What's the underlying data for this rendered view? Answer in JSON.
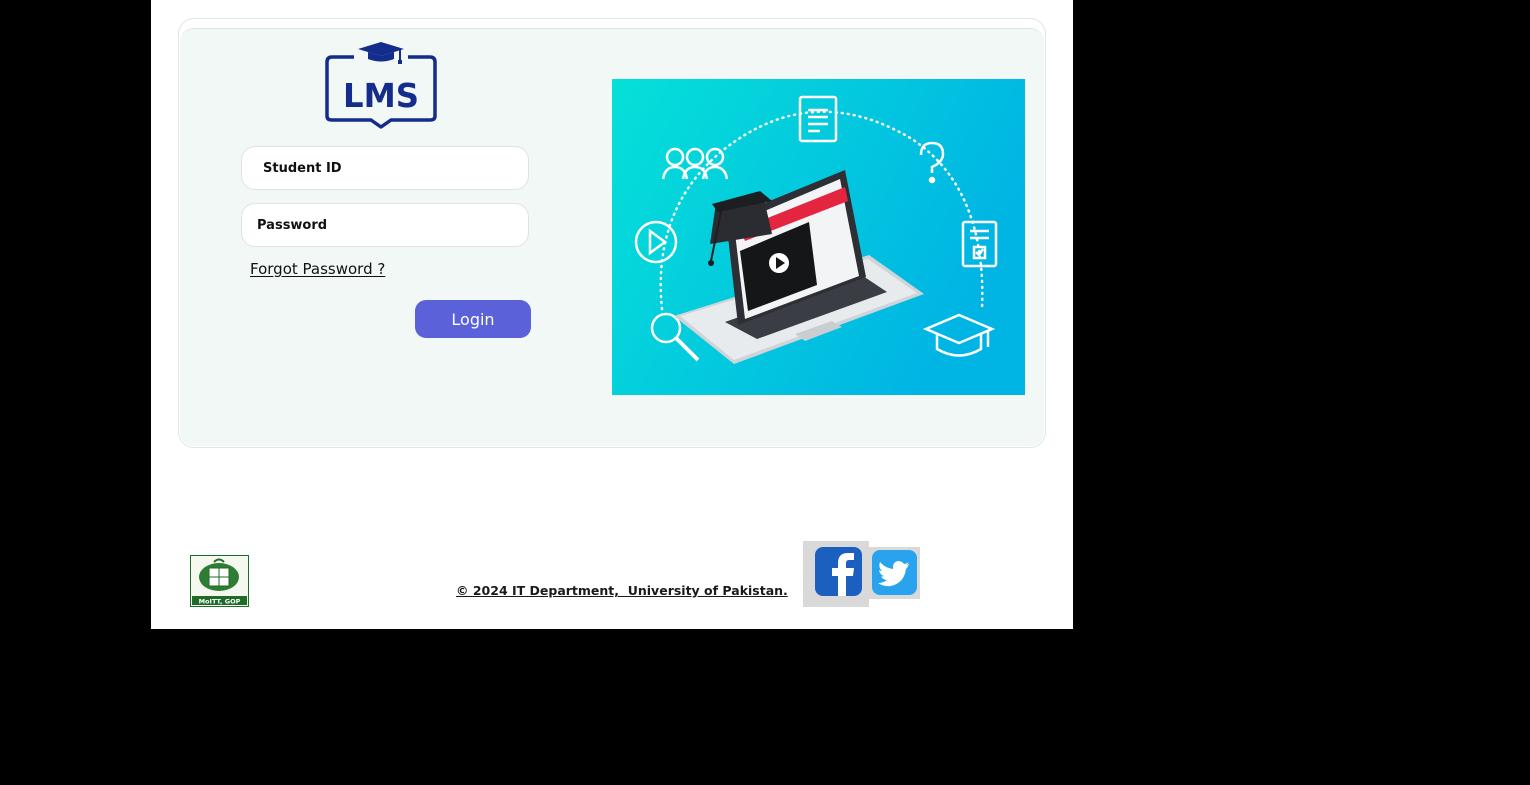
{
  "logo": {
    "text": "LMS",
    "icon": "graduation-cap-book-icon",
    "color": "#142c8c"
  },
  "form": {
    "student_id_placeholder": "Student ID",
    "password_placeholder": "Password",
    "forgot_password": "Forgot Password ?",
    "login_button": "Login"
  },
  "hero": {
    "description_icons": [
      "users-icon",
      "document-icon",
      "question-icon",
      "play-icon",
      "checklist-icon",
      "search-icon",
      "graduation-cap-icon",
      "laptop-icon"
    ]
  },
  "footer": {
    "gov_logo_text": "MoITT, GOP",
    "copyright": "© 2024 IT Department,  University of Pakistan.",
    "social": [
      {
        "name": "facebook",
        "icon": "facebook-icon"
      },
      {
        "name": "twitter",
        "icon": "twitter-icon"
      }
    ]
  },
  "colors": {
    "accent": "#5b61d9",
    "card_bg": "#f2f8f6",
    "hero_from": "#06e0d8",
    "hero_to": "#00b4e4",
    "outer_bg": "#000000"
  }
}
